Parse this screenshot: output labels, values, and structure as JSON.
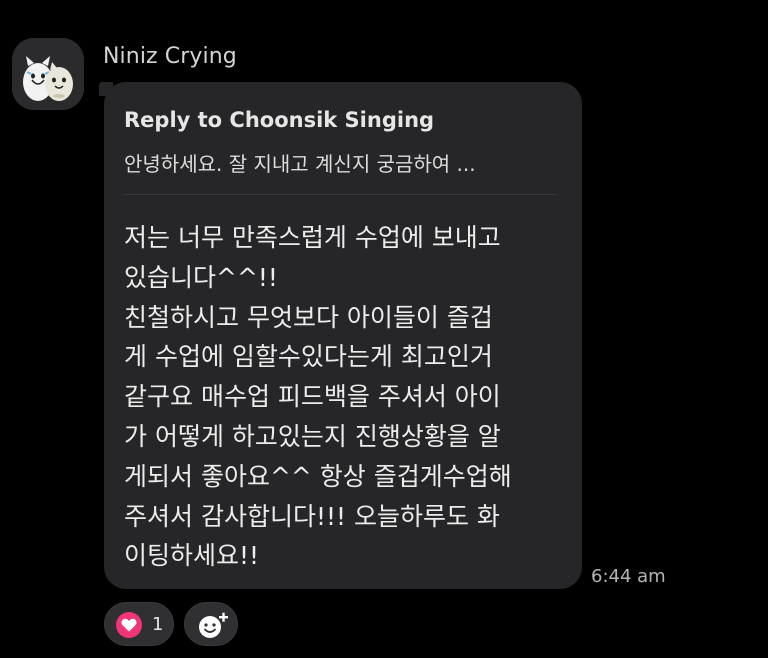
{
  "message": {
    "sender_name": "Niniz Crying",
    "avatar_icon": "niniz-characters-avatar",
    "reply": {
      "title": "Reply to Choonsik Singing",
      "preview": "안녕하세요. 잘 지내고 계신지 궁금하여 ..."
    },
    "body_lines": [
      "저는 너무 만족스럽게 수업에 보내고",
      "있습니다^^!!",
      "친철하시고 무엇보다 아이들이 즐겁",
      "게 수업에 임할수있다는게 최고인거",
      "같구요 매수업 피드백을 주셔서 아이",
      "가 어떻게 하고있는지 진행상황을 알",
      "게되서 좋아요^^ 항상 즐겁게수업해",
      "주셔서 감사합니다!!! 오늘하루도 화",
      "이팅하세요!!"
    ],
    "timestamp": "6:44 am"
  },
  "reactions": {
    "heart": {
      "icon": "heart-icon",
      "count": "1",
      "color": "#f0357a"
    },
    "add_reaction_icon": "add-emoji-icon"
  },
  "colors": {
    "background": "#000000",
    "bubble": "#262628",
    "accent_heart": "#f0357a"
  }
}
